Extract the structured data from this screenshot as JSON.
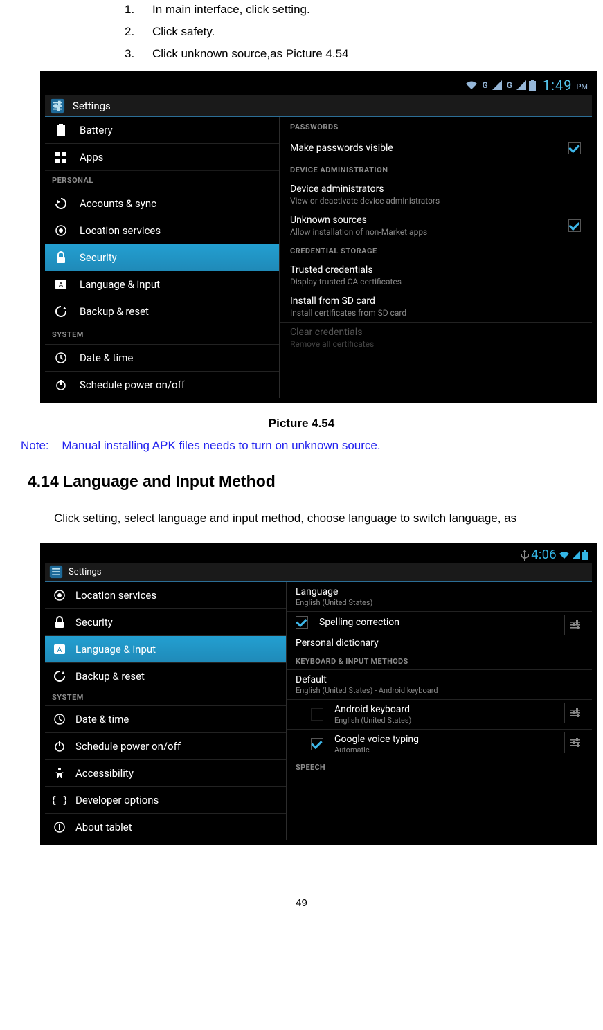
{
  "steps": [
    {
      "num": "1.",
      "text": "In main interface, click setting."
    },
    {
      "num": "2.",
      "text": "Click safety."
    },
    {
      "num": "3.",
      "text": "Click unknown source,as Picture 4.54"
    }
  ],
  "shot1": {
    "status": {
      "time": "1:49",
      "pm": "PM",
      "g": "G"
    },
    "title": "Settings",
    "sidebar_heads": {
      "personal": "PERSONAL",
      "system": "SYSTEM"
    },
    "sidebar": {
      "battery": "Battery",
      "apps": "Apps",
      "accounts": "Accounts & sync",
      "location": "Location services",
      "security": "Security",
      "lang": "Language & input",
      "backup": "Backup & reset",
      "datetime": "Date & time",
      "schedule": "Schedule power on/off"
    },
    "right_heads": {
      "passwords": "PASSWORDS",
      "device": "DEVICE ADMINISTRATION",
      "cred": "CREDENTIAL STORAGE"
    },
    "right": {
      "makepw": {
        "t": "Make passwords visible"
      },
      "devadmin": {
        "t": "Device administrators",
        "s": "View or deactivate device administrators"
      },
      "unknown": {
        "t": "Unknown sources",
        "s": "Allow installation of non-Market apps"
      },
      "trusted": {
        "t": "Trusted credentials",
        "s": "Display trusted CA certificates"
      },
      "installsd": {
        "t": "Install from SD card",
        "s": "Install certificates from SD card"
      },
      "clear": {
        "t": "Clear credentials",
        "s": "Remove all certificates"
      }
    }
  },
  "caption1": "Picture 4.54",
  "note_label": "Note:",
  "note_text": "Manual installing APK files needs to turn on unknown source.",
  "section_heading": "4.14 Language and Input Method",
  "paragraph": "Click setting, select language and input method, choose language to switch language, as",
  "shot2": {
    "status": {
      "time": "4:06"
    },
    "title": "Settings",
    "sidebar_heads": {
      "system": "SYSTEM"
    },
    "sidebar": {
      "location": "Location services",
      "security": "Security",
      "lang": "Language & input",
      "backup": "Backup & reset",
      "datetime": "Date & time",
      "schedule": "Schedule power on/off",
      "access": "Accessibility",
      "dev": "Developer options",
      "about": "About tablet"
    },
    "right_heads": {
      "kb": "KEYBOARD & INPUT METHODS",
      "speech": "SPEECH"
    },
    "right": {
      "language": {
        "t": "Language",
        "s": "English (United States)"
      },
      "spelling": {
        "t": "Spelling correction"
      },
      "pdict": {
        "t": "Personal dictionary"
      },
      "default": {
        "t": "Default",
        "s": "English (United States) - Android keyboard"
      },
      "akb": {
        "t": "Android keyboard",
        "s": "English (United States)"
      },
      "gvt": {
        "t": "Google voice typing",
        "s": "Automatic"
      }
    }
  },
  "page_number": "49"
}
